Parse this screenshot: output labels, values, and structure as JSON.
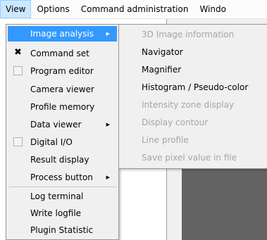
{
  "menubar": {
    "items": [
      "View",
      "Options",
      "Command administration",
      "Windo"
    ]
  },
  "view_menu": {
    "items": [
      {
        "label": "Image analysis",
        "submenu": true,
        "selected": true
      },
      {
        "label": "Command set",
        "check": "x"
      },
      {
        "label": "Program editor",
        "check": "box"
      },
      {
        "label": "Camera viewer"
      },
      {
        "label": "Profile memory"
      },
      {
        "label": "Data viewer",
        "submenu": true
      },
      {
        "label": "Digital I/O",
        "check": "box"
      },
      {
        "label": "Result display"
      },
      {
        "label": "Process button",
        "submenu": true
      },
      {
        "label": "Log terminal"
      },
      {
        "label": "Write logfile"
      },
      {
        "label": "Plugin Statistic"
      }
    ],
    "submenu_arrow": "▶"
  },
  "image_analysis_submenu": {
    "items": [
      {
        "label": "3D Image information",
        "enabled": false
      },
      {
        "label": "Navigator",
        "enabled": true
      },
      {
        "label": "Magnifier",
        "enabled": true
      },
      {
        "label": "Histogram / Pseudo-color",
        "enabled": true
      },
      {
        "label": "Intensity zone display",
        "enabled": false
      },
      {
        "label": "Display contour",
        "enabled": false
      },
      {
        "label": "Line profile",
        "enabled": false
      },
      {
        "label": "Save pixel value in file",
        "enabled": false
      }
    ]
  },
  "colors": {
    "highlight": "#3399ff",
    "disabled_text": "#a5a5a5",
    "menu_bg": "#f0f0f0",
    "active_menubar": "#cce8ff"
  }
}
